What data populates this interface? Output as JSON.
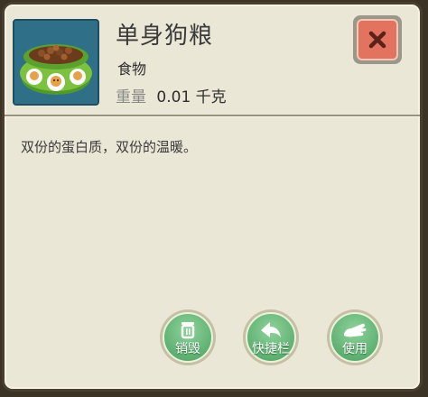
{
  "item": {
    "name": "单身狗粮",
    "category": "食物",
    "weight_label": "重量",
    "weight_value": "0.01 千克",
    "description": "双份的蛋白质，双份的温暖。",
    "thumbnail_icon": "dog-food-bowl-icon"
  },
  "close_icon": "close-icon",
  "actions": [
    {
      "label": "销毁",
      "icon": "trash-icon"
    },
    {
      "label": "快捷栏",
      "icon": "arrow-left-icon"
    },
    {
      "label": "使用",
      "icon": "hand-icon"
    }
  ],
  "colors": {
    "panel_bg": "#ebe7d6",
    "close_red": "#e2735f",
    "action_green": "#5fb072",
    "thumb_bg": "#2f6f87"
  }
}
